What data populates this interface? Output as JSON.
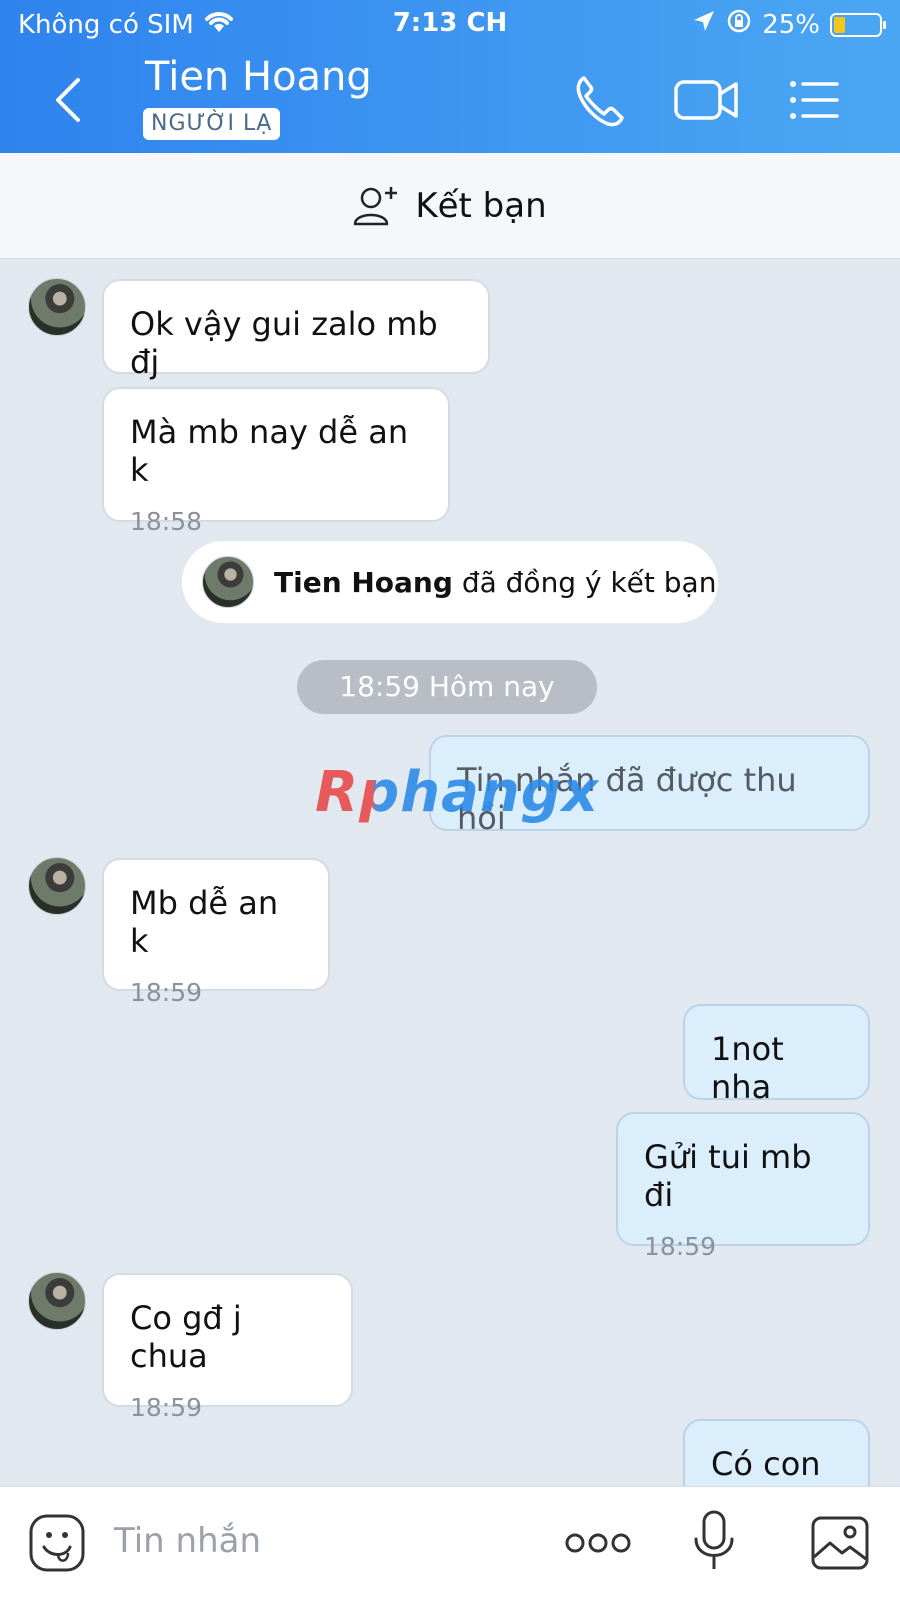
{
  "status": {
    "carrier": "Không có SIM",
    "time": "7:13 CH",
    "battery": "25%",
    "battery_level": 0.25
  },
  "header": {
    "title": "Tien Hoang",
    "badge": "NGƯỜI LẠ"
  },
  "add_friend": {
    "label": "Kết bạn"
  },
  "messages": [
    {
      "text": "Ok vậy gui zalo mb đj"
    },
    {
      "text": "Mà mb nay dễ an k",
      "time": "18:58"
    },
    {
      "system_name": "Tien Hoang",
      "system_text": "đã đồng ý kết bạn"
    },
    {
      "date": "18:59 Hôm nay"
    },
    {
      "text": "Tin nhắn đã được thu hồi"
    },
    {
      "text": "Mb dễ an k",
      "time": "18:59"
    },
    {
      "text": "1not nha"
    },
    {
      "text": "Gửi tui mb đi",
      "time": "18:59"
    },
    {
      "text": "Co gđ j chua",
      "time": "18:59"
    },
    {
      "text": "Có con r"
    }
  ],
  "watermark": "Rphangx",
  "input": {
    "placeholder": "Tin nhắn"
  }
}
